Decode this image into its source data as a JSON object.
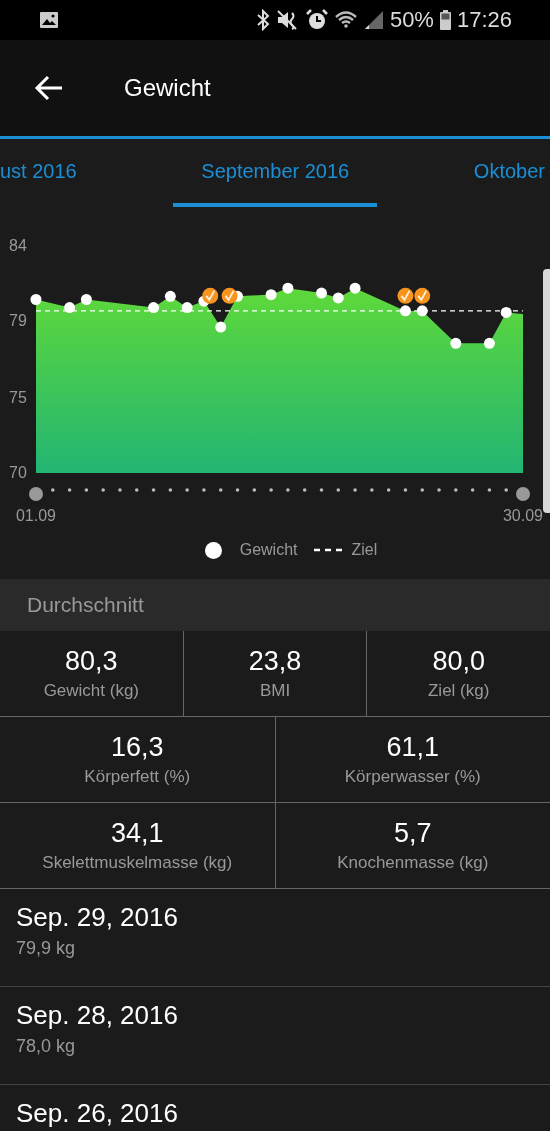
{
  "status_bar": {
    "battery": "50%",
    "time": "17:26"
  },
  "app_bar": {
    "title": "Gewicht"
  },
  "tabs": [
    {
      "label": "ust 2016",
      "selected": false
    },
    {
      "label": "September 2016",
      "selected": true
    },
    {
      "label": "Oktober",
      "selected": false
    }
  ],
  "chart": {
    "chart_data": {
      "type": "area",
      "categories": [
        "01.09",
        null,
        null,
        null,
        null,
        null,
        null,
        null,
        null,
        null,
        null,
        null,
        null,
        null,
        null,
        null,
        null,
        null,
        null,
        null,
        null,
        null,
        null,
        null,
        null,
        null,
        null,
        null,
        null,
        "30.09"
      ],
      "series": [
        {
          "name": "Gewicht",
          "color": "#ffffff",
          "values": [
            80.7,
            null,
            80.2,
            80.7,
            null,
            null,
            null,
            80.2,
            80.9,
            80.2,
            80.6,
            79.0,
            80.9,
            null,
            81.0,
            81.4,
            null,
            81.1,
            80.8,
            81.4,
            null,
            null,
            80.0,
            80.0,
            null,
            78.0,
            null,
            78.0,
            79.9,
            79.8
          ]
        },
        {
          "name": "Ziel",
          "type": "line",
          "line_style": "dashed",
          "color": "#ffffff",
          "values": [
            80.0,
            80.0,
            80.0,
            80.0,
            80.0,
            80.0,
            80.0,
            80.0,
            80.0,
            80.0,
            80.0,
            80.0,
            80.0,
            80.0,
            80.0,
            80.0,
            80.0,
            80.0,
            80.0,
            80.0,
            80.0,
            80.0,
            80.0,
            80.0,
            80.0,
            80.0,
            80.0,
            80.0,
            80.0,
            80.0
          ]
        }
      ],
      "ylim": [
        70,
        84
      ],
      "yticks": [
        {
          "value": 70,
          "label": "70"
        },
        {
          "value": 74.6,
          "label": "75"
        },
        {
          "value": 79.4,
          "label": "79"
        },
        {
          "value": 84,
          "label": "84"
        }
      ],
      "stacked": false
    }
  },
  "summary": {
    "title": "Durchschnitt",
    "rows": [
      [
        {
          "value": "80,3",
          "label": "Gewicht (kg)"
        },
        {
          "value": "23,8",
          "label": "BMI"
        },
        {
          "value": "80,0",
          "label": "Ziel (kg)"
        }
      ],
      [
        {
          "value": "16,3",
          "label": "Körperfett (%)"
        },
        {
          "value": "61,1",
          "label": "Körperwasser (%)"
        }
      ],
      [
        {
          "value": "34,1",
          "label": "Skelettmuskelmasse (kg)"
        },
        {
          "value": "5,7",
          "label": "Knochenmasse (kg)"
        }
      ]
    ]
  },
  "entries": [
    {
      "date": "Sep. 29, 2016",
      "weight": "79,9 kg"
    },
    {
      "date": "Sep. 28, 2016",
      "weight": "78,0 kg"
    },
    {
      "date": "Sep. 26, 2016"
    }
  ]
}
